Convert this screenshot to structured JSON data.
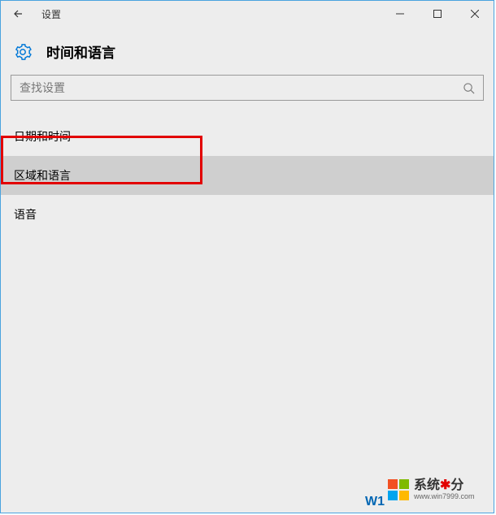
{
  "titlebar": {
    "title": "设置"
  },
  "header": {
    "page_title": "时间和语言"
  },
  "search": {
    "placeholder": "查找设置"
  },
  "nav": {
    "items": [
      {
        "label": "日期和时间",
        "selected": false
      },
      {
        "label": "区域和语言",
        "selected": true
      },
      {
        "label": "语音",
        "selected": false
      }
    ]
  },
  "watermark": {
    "partial_text": "W1",
    "brand": "系统",
    "brand_suffix": "分",
    "url": "www.win7999.com"
  }
}
